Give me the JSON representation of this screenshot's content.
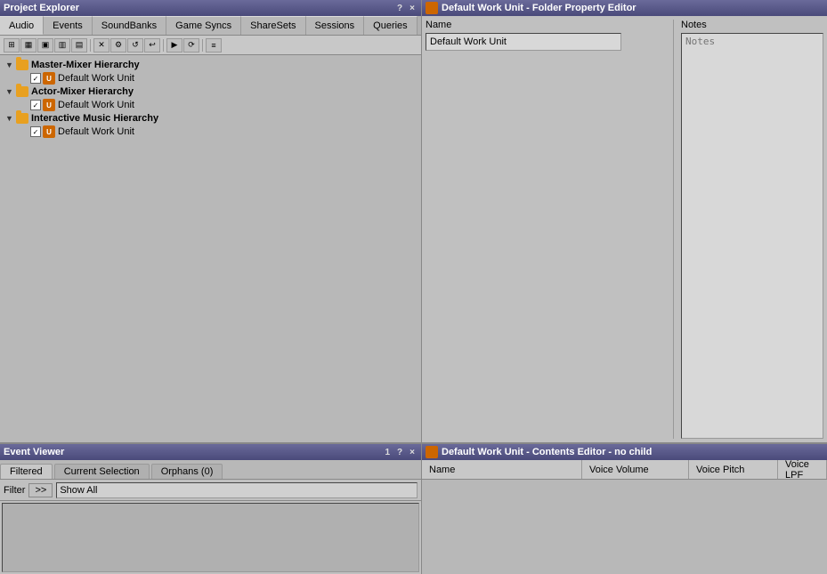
{
  "project_explorer": {
    "title": "Project Explorer",
    "title_controls": [
      "?",
      "×"
    ],
    "tabs": [
      {
        "label": "Audio",
        "active": true
      },
      {
        "label": "Events"
      },
      {
        "label": "SoundBanks"
      },
      {
        "label": "Game Syncs"
      },
      {
        "label": "ShareSets"
      },
      {
        "label": "Sessions"
      },
      {
        "label": "Queries"
      }
    ],
    "toolbar_buttons": [
      "□",
      "▦",
      "▣",
      "▥",
      "▤",
      "⊞",
      "✕",
      "⚙",
      "↺",
      "↩",
      "▶",
      "⟳"
    ],
    "tree": [
      {
        "id": "master-mixer",
        "label": "Master-Mixer Hierarchy",
        "indent": 1,
        "type": "folder",
        "bold": true,
        "expanded": true
      },
      {
        "id": "master-mixer-dwu",
        "label": "Default Work Unit",
        "indent": 2,
        "type": "workunit",
        "checked": true
      },
      {
        "id": "actor-mixer",
        "label": "Actor-Mixer Hierarchy",
        "indent": 1,
        "type": "folder",
        "bold": true,
        "expanded": true
      },
      {
        "id": "actor-mixer-dwu",
        "label": "Default Work Unit",
        "indent": 2,
        "type": "workunit",
        "checked": true
      },
      {
        "id": "interactive-music",
        "label": "Interactive Music Hierarchy",
        "indent": 1,
        "type": "folder",
        "bold": true,
        "expanded": true
      },
      {
        "id": "interactive-music-dwu",
        "label": "Default Work Unit",
        "indent": 2,
        "type": "workunit",
        "checked": true
      }
    ]
  },
  "property_editor": {
    "title": "Default Work Unit - Folder Property Editor",
    "title_icon": "orange",
    "name_label": "Name",
    "name_value": "Default Work Unit",
    "notes_label": "Notes",
    "notes_placeholder": "Notes"
  },
  "event_viewer": {
    "title": "Event Viewer",
    "title_controls": [
      "1",
      "?",
      "×"
    ],
    "tabs": [
      {
        "label": "Filtered",
        "active": true
      },
      {
        "label": "Current Selection"
      },
      {
        "label": "Orphans (0)"
      }
    ],
    "filter_label": "Filter",
    "filter_button": ">>",
    "filter_value": "Show All"
  },
  "contents_editor": {
    "title": "Default Work Unit - Contents Editor - no child",
    "title_icon": "orange",
    "columns": [
      {
        "label": "Name"
      },
      {
        "label": "Voice Volume"
      },
      {
        "label": "Voice Pitch"
      },
      {
        "label": "Voice LPF"
      }
    ]
  }
}
